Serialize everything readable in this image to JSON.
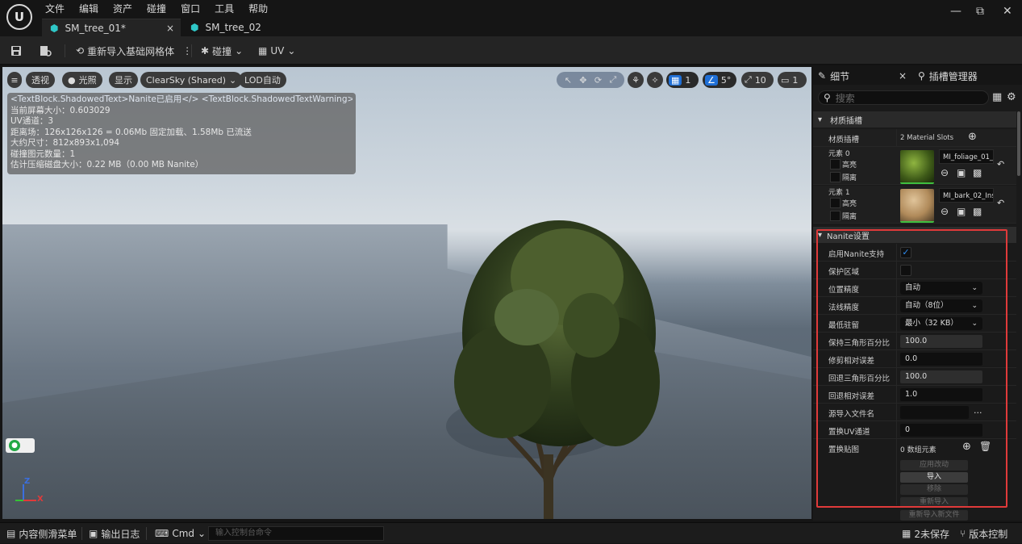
{
  "menu": [
    "文件",
    "编辑",
    "资产",
    "碰撞",
    "窗口",
    "工具",
    "帮助"
  ],
  "tabs": [
    {
      "label": "SM_tree_01*",
      "close": "×"
    },
    {
      "label": "SM_tree_02"
    }
  ],
  "window_controls": {
    "minimize": "—",
    "restore": "⧉",
    "close": "✕"
  },
  "toolbar": {
    "reimport_label": "重新导入基础网格体",
    "collision_label": "碰撞",
    "uv_label": "UV"
  },
  "viewport": {
    "menu_icon": "≡",
    "perspective_label": "透视",
    "lit_label": "光照",
    "show_label": "显示",
    "sky_label": "ClearSky (Shared)",
    "lod_label": "LOD自动",
    "grid_snap_value": "1",
    "angle_snap_value": "5°",
    "scale_snap_value": "10",
    "camera_speed_value": "1",
    "stats_lines": [
      "<TextBlock.ShadowedText>Nanite已启用</> <TextBlock.ShadowedTextWarning></>",
      "当前屏幕大小：0.603029",
      "UV通道：3",
      "距离场：126x126x126 = 0.06Mb 固定加载、1.58Mb 已流送",
      "大约尺寸：812x893x1,094",
      "碰撞图元数量：1",
      "估计压缩磁盘大小：0.22 MB（0.00 MB Nanite）"
    ],
    "axis": {
      "z": "Z",
      "x": "X"
    }
  },
  "details_panel": {
    "tab_details": "细节",
    "tab_close": "×",
    "tab_sockets": "插槽管理器",
    "search_placeholder": "搜索",
    "material_section": {
      "header": "材质插槽",
      "slots_label": "材质插槽",
      "slots_count": "2 Material Slots",
      "elements": [
        {
          "label": "元素 0",
          "highlight": "高亮",
          "isolate": "隔离",
          "material": "MI_foliage_01_In"
        },
        {
          "label": "元素 1",
          "highlight": "高亮",
          "isolate": "隔离",
          "material": "MI_bark_02_Ins"
        }
      ]
    },
    "nanite_section": {
      "header": "Nanite设置",
      "rows": {
        "enable": {
          "label": "启用Nanite支持",
          "checked": true
        },
        "preserve_area": {
          "label": "保护区域",
          "checked": false
        },
        "position_precision": {
          "label": "位置精度",
          "value": "自动"
        },
        "normal_precision": {
          "label": "法线精度",
          "value": "自动（8位）"
        },
        "min_residency": {
          "label": "最低驻留",
          "value": "最小（32 KB）"
        },
        "keep_triangle_percent": {
          "label": "保持三角形百分比",
          "value": "100.0"
        },
        "trim_relative_error": {
          "label": "修剪相对误差",
          "value": "0.0"
        },
        "fallback_triangle_percent": {
          "label": "回退三角形百分比",
          "value": "100.0"
        },
        "fallback_relative_error": {
          "label": "回退相对误差",
          "value": "1.0"
        },
        "source_import_filename": {
          "label": "源导入文件名",
          "value": ""
        },
        "override_uv_channel": {
          "label": "置换UV通道",
          "value": "0"
        },
        "displacement_maps": {
          "label": "置换贴图",
          "value": "0 数组元素"
        }
      },
      "buttons": {
        "apply": "应用改动",
        "import": "导入",
        "remove": "移除",
        "reimport": "重新导入",
        "reimport_new": "重新导入新文件"
      },
      "more": "..."
    }
  },
  "statusbar": {
    "content_drawer": "内容侧滑菜单",
    "output_log": "输出日志",
    "cmd_label": "Cmd",
    "cmd_placeholder": "输入控制台命令",
    "unsaved": "2未保存",
    "version_control": "版本控制"
  }
}
